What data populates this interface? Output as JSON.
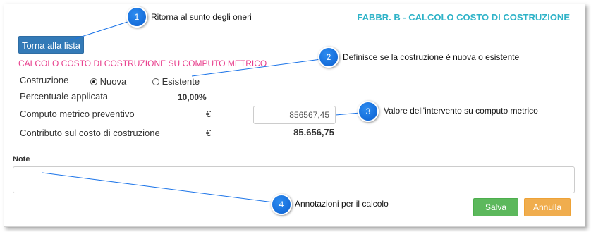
{
  "header": {
    "title": "FABBR. B - CALCOLO COSTO DI COSTRUZIONE"
  },
  "toolbar": {
    "back_label": "Torna alla lista"
  },
  "section": {
    "title": "CALCOLO COSTO DI COSTRUZIONE SU COMPUTO METRICO"
  },
  "form": {
    "costruzione_label": "Costruzione",
    "options": [
      {
        "label": "Nuova",
        "checked": true
      },
      {
        "label": "Esistente",
        "checked": false
      }
    ],
    "percentuale_label": "Percentuale applicata",
    "percentuale_value": "10,00%",
    "computo_label": "Computo metrico preventivo",
    "computo_currency": "€",
    "computo_value": "856567,45",
    "contributo_label": "Contributo sul costo di costruzione",
    "contributo_currency": "€",
    "contributo_value": "85.656,75",
    "note_label": "Note",
    "note_value": ""
  },
  "actions": {
    "save_label": "Salva",
    "cancel_label": "Annulla"
  },
  "callouts": [
    {
      "number": "1",
      "text": "Ritorna al sunto degli oneri"
    },
    {
      "number": "2",
      "text": "Definisce se la costruzione è nuova o esistente"
    },
    {
      "number": "3",
      "text": "Valore dell'intervento su computo metrico"
    },
    {
      "number": "4",
      "text": "Annotazioni per il calcolo"
    }
  ],
  "colors": {
    "title": "#2fb3c8",
    "section_title": "#e83e8c",
    "primary": "#337ab7",
    "success": "#5cb85c",
    "warning": "#f0ad4e",
    "callout": "#1a73e8"
  }
}
